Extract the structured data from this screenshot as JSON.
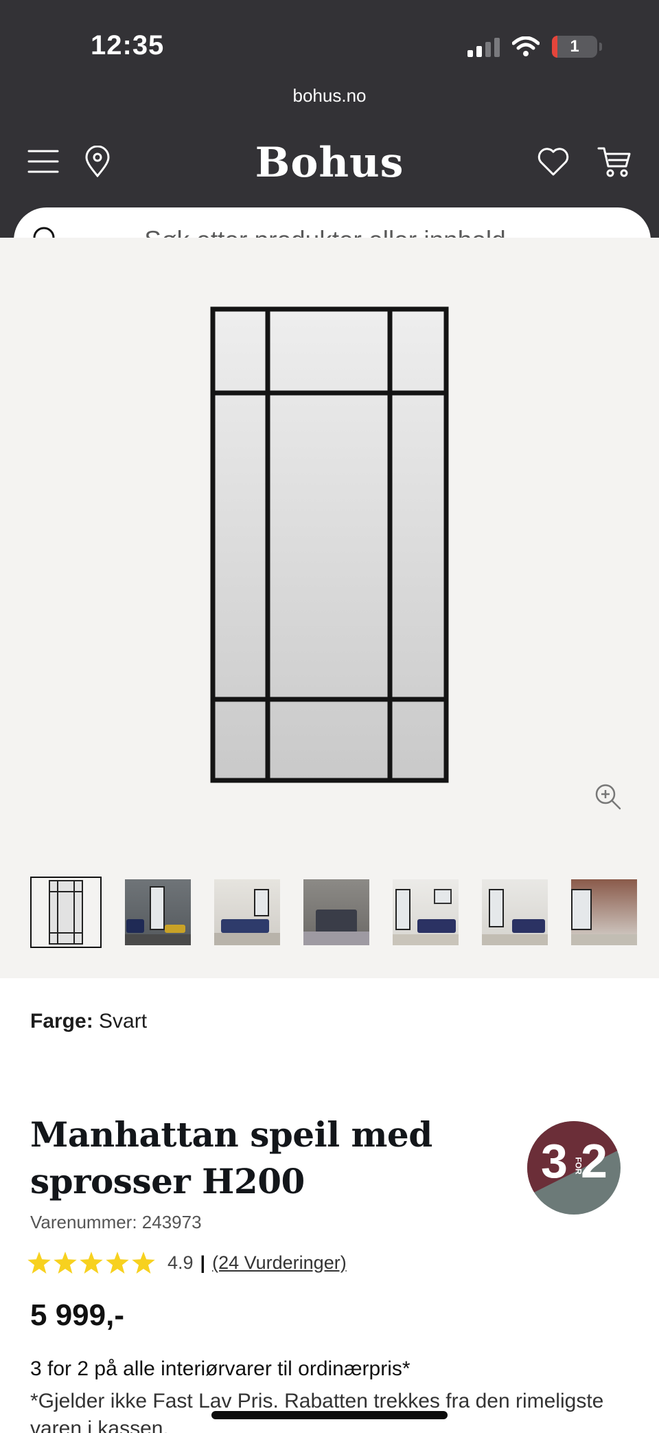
{
  "status_bar": {
    "time": "12:35",
    "battery_level": "1"
  },
  "browser": {
    "url": "bohus.no"
  },
  "header": {
    "logo": "Bohus"
  },
  "search": {
    "placeholder": "Søk etter produkter eller innhold ..."
  },
  "gallery": {
    "thumbnail_count": 7,
    "active_index": 0
  },
  "product": {
    "color_label": "Farge:",
    "color_value": "Svart",
    "title": "Manhattan speil med sprosser H200",
    "sku_label": "Varenummer: 243973",
    "rating_value": "4.9",
    "rating_stars": 5,
    "rating_separator": "|",
    "rating_count": "(24 Vurderinger)",
    "price": "5 999,-",
    "badge": {
      "left": "3",
      "middle": "FOR",
      "right": "2"
    },
    "promo_title": "3 for 2 på alle interiørvarer til ordinærpris*",
    "promo_text": "*Gjelder ikke Fast Lav Pris. Rabatten trekkes fra den rimeligste varen i kassen."
  },
  "colors": {
    "header_bg": "#333236",
    "gallery_bg": "#f4f3f1",
    "star": "#f7d11f",
    "badge_maroon": "#6b2e38",
    "badge_gray": "#6c7a78"
  }
}
